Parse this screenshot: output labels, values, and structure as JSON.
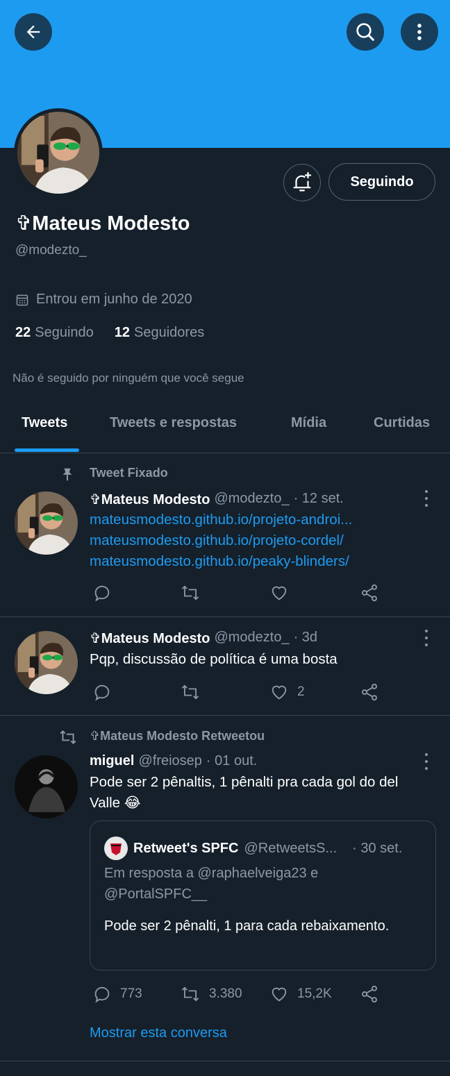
{
  "colors": {
    "accent": "#1d9bf0",
    "background": "#15202b",
    "muted": "#8b98a5",
    "border": "#38444d"
  },
  "header": {
    "back_icon": "arrow-left-icon",
    "search_icon": "search-icon",
    "more_icon": "more-vertical-icon"
  },
  "profile": {
    "name": "✞Mateus Modesto",
    "handle": "@modezto_",
    "joined": "Entrou em junho de 2020",
    "following_count": "22",
    "following_label": "Seguindo",
    "followers_count": "12",
    "followers_label": "Seguidores",
    "not_followed_text": "Não é seguido por ninguém que você segue",
    "follow_button": "Seguindo",
    "bell_icon": "bell-plus-icon",
    "calendar_icon": "calendar-icon"
  },
  "tabs": [
    {
      "label": "Tweets"
    },
    {
      "label": "Tweets e respostas"
    },
    {
      "label": "Mídia"
    },
    {
      "label": "Curtidas"
    }
  ],
  "tweets": [
    {
      "pinned_label": "Tweet Fixado",
      "name": "✞Mateus Modesto",
      "handle": "@modezto_",
      "time": "· 12 set.",
      "links": [
        "mateusmodesto.github.io/projeto-androi...",
        "mateusmodesto.github.io/projeto-cordel/",
        "mateusmodesto.github.io/peaky-blinders/"
      ]
    },
    {
      "name": "✞Mateus Modesto",
      "handle": "@modezto_",
      "time": "· 3d",
      "text": "Pqp, discussão de política é uma bosta",
      "likes": "2"
    },
    {
      "retweet_label": "✞Mateus Modesto Retweetou",
      "name": "miguel",
      "handle": "@freiosep",
      "time": "· 01 out.",
      "text": "Pode ser 2 pênaltis, 1 pênalti pra cada gol do del Valle 😂",
      "quote": {
        "name": "Retweet's SPFC",
        "handle": "@RetweetsS...",
        "time": "· 30 set.",
        "reply_to": "Em resposta a @raphaelveiga23 e @PortalSPFC__",
        "text": "Pode ser 2 pênalti, 1 para cada rebaixamento."
      },
      "replies": "773",
      "retweets": "3.380",
      "likes": "15,2K",
      "show_conversation": "Mostrar esta conversa"
    }
  ]
}
